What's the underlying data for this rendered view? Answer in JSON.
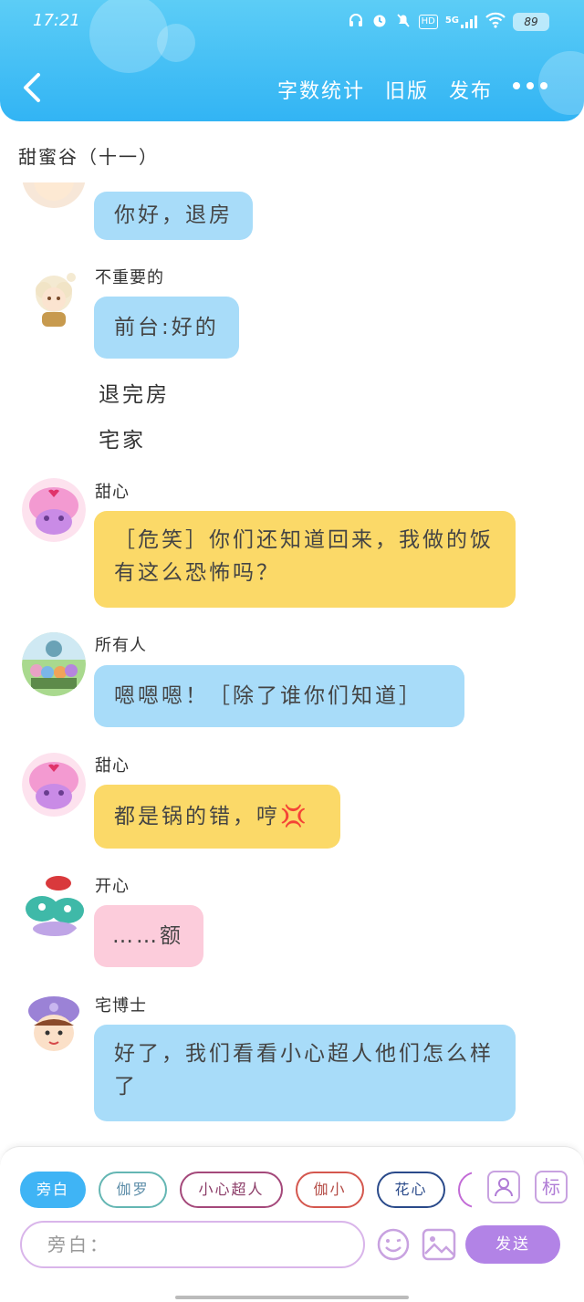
{
  "status_bar": {
    "time": "17:21",
    "network": "5G",
    "hd": "HD",
    "battery": "89"
  },
  "header": {
    "nav": [
      "字数统计",
      "旧版",
      "发布"
    ]
  },
  "title": "甜蜜谷（十一）",
  "messages": [
    {
      "text": "你好，退房"
    },
    {
      "name": "不重要的",
      "text": "前台:好的"
    },
    {
      "text": "退完房"
    },
    {
      "text": "宅家"
    },
    {
      "name": "甜心",
      "text": "［危笑］你们还知道回来，我做的饭有这么恐怖吗？"
    },
    {
      "name": "所有人",
      "text": "嗯嗯嗯！［除了谁你们知道］"
    },
    {
      "name": "甜心",
      "text": "都是锅的错，哼💢"
    },
    {
      "name": "开心",
      "text": "……额"
    },
    {
      "name": "宅博士",
      "text": "好了，我们看看小心超人他们怎么样了"
    }
  ],
  "chips": [
    "旁白",
    "伽罗",
    "小心超人",
    "伽小",
    "花心"
  ],
  "tools": {
    "tag_label": "标"
  },
  "input": {
    "placeholder": "旁白："
  },
  "send_label": "发送",
  "colors": {
    "header": "#32b4f4",
    "blue_bubble": "#a8dcf9",
    "yellow_bubble": "#fbd968",
    "pink_bubble": "#fcccdb",
    "send": "#b283e6"
  }
}
